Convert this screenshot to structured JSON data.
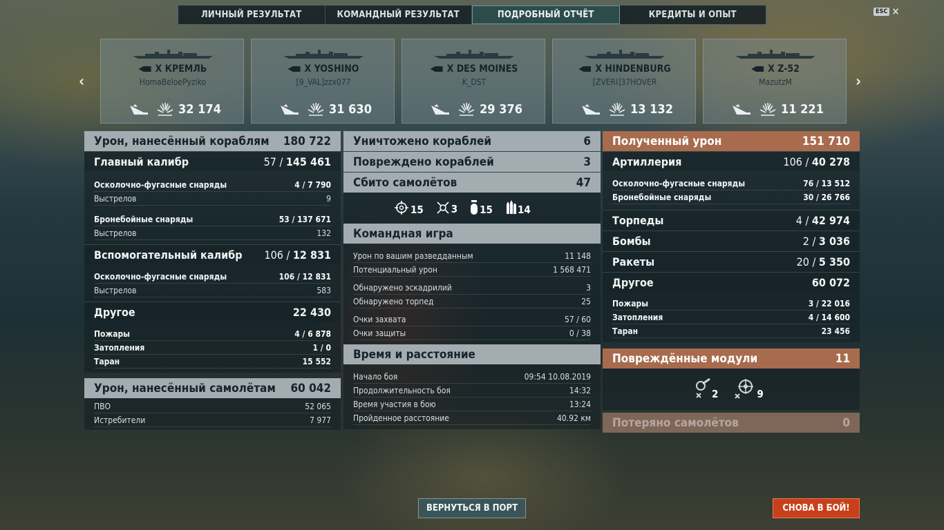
{
  "tabs": [
    "ЛИЧНЫЙ РЕЗУЛЬТАТ",
    "КОМАНДНЫЙ РЕЗУЛЬТАТ",
    "ПОДРОБНЫЙ ОТЧЁТ",
    "КРЕДИТЫ И ОПЫТ"
  ],
  "active_tab": "ПОДРОБНЫЙ ОТЧЁТ",
  "esc_label": "ESC",
  "esc_close": "✕",
  "nav": {
    "prev": "‹",
    "next": "›"
  },
  "ships": [
    {
      "name": "X КРЕМЛЬ",
      "player": "HomaBeloePyziko",
      "damage": "32 174"
    },
    {
      "name": "X YOSHINO",
      "player": "[9_VAL]zzx077",
      "damage": "31 630"
    },
    {
      "name": "X DES MOINES",
      "player": "K_DST",
      "damage": "29 376"
    },
    {
      "name": "X HINDENBURG",
      "player": "[ZVERI]37HOVER",
      "damage": "13 132"
    },
    {
      "name": "X Z-52",
      "player": "MazutzM",
      "damage": "11 221"
    }
  ],
  "left": {
    "ship_damage": {
      "label": "Урон, нанесённый кораблям",
      "value": "180 722"
    },
    "main": {
      "label": "Главный калибр",
      "hits": "57 / ",
      "value": "145 461"
    },
    "main_rows": [
      {
        "label": "Осколочно-фугасные снаряды",
        "hits": "4 / ",
        "value": "7 790"
      },
      {
        "label": "Выстрелов",
        "value": "9"
      },
      {
        "label": "Бронебойные снаряды",
        "hits": "53 / ",
        "value": "137 671"
      },
      {
        "label": "Выстрелов",
        "value": "132"
      }
    ],
    "secondary": {
      "label": "Вспомогательный калибр",
      "hits": "106 / ",
      "value": "12 831"
    },
    "secondary_rows": [
      {
        "label": "Осколочно-фугасные снаряды",
        "hits": "106 / ",
        "value": "12 831"
      },
      {
        "label": "Выстрелов",
        "value": "583"
      }
    ],
    "other": {
      "label": "Другое",
      "value": "22 430"
    },
    "other_rows": [
      {
        "label": "Пожары",
        "hits": "4 / ",
        "value": "6 878"
      },
      {
        "label": "Затопления",
        "hits": "1 / ",
        "value": "0"
      },
      {
        "label": "Таран",
        "value": "15 552"
      }
    ],
    "plane_damage": {
      "label": "Урон, нанесённый самолётам",
      "value": "60 042"
    },
    "plane_rows": [
      {
        "label": "ПВО",
        "value": "52 065"
      },
      {
        "label": "Истребители",
        "value": "7 977"
      }
    ]
  },
  "center": {
    "destroyed": {
      "label": "Уничтожено кораблей",
      "value": "6"
    },
    "damaged": {
      "label": "Повреждено кораблей",
      "value": "3"
    },
    "planes": {
      "label": "Сбито самолётов",
      "value": "47"
    },
    "icons": [
      {
        "name": "main-battery-hits-icon",
        "value": "15"
      },
      {
        "name": "torpedo-hits-icon",
        "value": "3"
      },
      {
        "name": "bomb-hits-icon",
        "value": "15"
      },
      {
        "name": "rocket-hits-icon",
        "value": "14"
      }
    ],
    "team": {
      "label": "Командная игра"
    },
    "team_rows": [
      {
        "label": "Урон по вашим разведданным",
        "value": "11 148"
      },
      {
        "label": "Потенциальный урон",
        "value": "1 568 471"
      },
      {
        "label": "Обнаружено эскадрилий",
        "value": "3"
      },
      {
        "label": "Обнаружено торпед",
        "value": "25"
      },
      {
        "label": "Очки захвата",
        "value": "57 / 60"
      },
      {
        "label": "Очки защиты",
        "value": "0 / 38"
      }
    ],
    "time": {
      "label": "Время и расстояние"
    },
    "time_rows": [
      {
        "label": "Начало боя",
        "value": "09:54  10.08.2019"
      },
      {
        "label": "Продолжительность боя",
        "value": "14:32"
      },
      {
        "label": "Время участия в бою",
        "value": "13:24"
      },
      {
        "label": "Пройденное расстояние",
        "value": "40.92 км"
      }
    ]
  },
  "right": {
    "received": {
      "label": "Полученный урон",
      "value": "151 710"
    },
    "artillery": {
      "label": "Артиллерия",
      "hits": "106 / ",
      "value": "40 278"
    },
    "artillery_rows": [
      {
        "label": "Осколочно-фугасные снаряды",
        "hits": "76 / ",
        "value": "13 512"
      },
      {
        "label": "Бронебойные снаряды",
        "hits": "30 / ",
        "value": "26 766"
      }
    ],
    "torpedoes": {
      "label": "Торпеды",
      "hits": "4 / ",
      "value": "42 974"
    },
    "bombs": {
      "label": "Бомбы",
      "hits": "2 / ",
      "value": "3 036"
    },
    "rockets": {
      "label": "Ракеты",
      "hits": "20 / ",
      "value": "5 350"
    },
    "other": {
      "label": "Другое",
      "value": "60 072"
    },
    "other_rows": [
      {
        "label": "Пожары",
        "hits": "3 / ",
        "value": "22 016"
      },
      {
        "label": "Затопления",
        "hits": "4 / ",
        "value": "14 600"
      },
      {
        "label": "Таран",
        "value": "23 456"
      }
    ],
    "modules": {
      "label": "Повреждённые модули",
      "value": "11"
    },
    "module_icons": [
      {
        "name": "gun-module-icon",
        "value": "2"
      },
      {
        "name": "steering-module-icon",
        "value": "9"
      }
    ],
    "lost_planes": {
      "label": "Потеряно самолётов",
      "value": "0"
    }
  },
  "buttons": {
    "port": "ВЕРНУТЬСЯ В ПОРТ",
    "battle": "СНОВА В БОЙ!"
  },
  "colors": {
    "accent_active_tab": "#2e4b4c",
    "received_header": "#a86b4d",
    "battle_button": "#c7401b",
    "port_button": "#3b5457"
  }
}
